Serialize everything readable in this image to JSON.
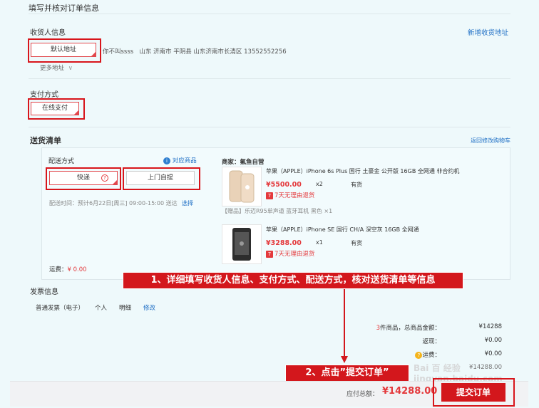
{
  "page_title": "填写并核对订单信息",
  "receiver": {
    "label": "收货人信息",
    "new_address": "新增收货地址",
    "default_address_btn": "默认地址",
    "address_text": "你不叫ssss   山东 济南市 平阴县 山东济南市长清区 13552552256",
    "more_address": "更多地址"
  },
  "payment": {
    "label": "支付方式",
    "online_pay": "在线支付"
  },
  "delivery": {
    "label": "送货清单",
    "back_to_cart": "返回修改购物车",
    "method_label": "配送方式",
    "goods_link": "对应商品",
    "express_btn": "快递",
    "pickup_btn": "上门自提",
    "time_text": "配送时间：预计6月22日[周三] 09:00-15:00 送达",
    "choose_link": "选择",
    "freight_label": "运费：",
    "freight_value": "¥ 0.00",
    "seller": "商家：氟鱼自营",
    "products": [
      {
        "name": "苹果（APPLE）iPhone 6s Plus 国行 土豪金 公开版 16GB 全网通 非合约机",
        "price": "¥5500.00",
        "qty": "x2",
        "stock": "有货",
        "return_note": "7天无理由退货",
        "gift": "【赠品】乐迈R95单声道 蓝牙耳机 黑色 ×1"
      },
      {
        "name": "苹果（APPLE）iPhone SE 国行 CH/A 深空灰 16GB 全网通",
        "price": "¥3288.00",
        "qty": "x1",
        "stock": "有货",
        "return_note": "7天无理由退货"
      }
    ]
  },
  "invoice": {
    "label": "发票信息",
    "type": "普通发票（电子）",
    "title": "个人",
    "content": "明细",
    "edit": "修改"
  },
  "summary": {
    "count_prefix": "3",
    "count_text": "件商品，总商品金额：",
    "total_goods": "¥14288",
    "rebate_label": "返现：",
    "rebate_value": "¥0.00",
    "freight_label": "运费：",
    "freight_value": "¥0.00",
    "payable_label": "应付总额：",
    "payable_value": "¥14288.00",
    "partial_amount": "¥14288.00"
  },
  "submit_label": "提交订单",
  "annotations": {
    "step1": "1、详细填写收货人信息、支付方式、配送方式，核对送货清单等信息",
    "step2": "2、点击”提交订单”"
  },
  "watermark": "Bai 百 经验 jingyan.baidu.com",
  "colors": {
    "accent_red": "#d3171c",
    "link_blue": "#1f6fc5",
    "page_bg": "#eef9fb"
  }
}
